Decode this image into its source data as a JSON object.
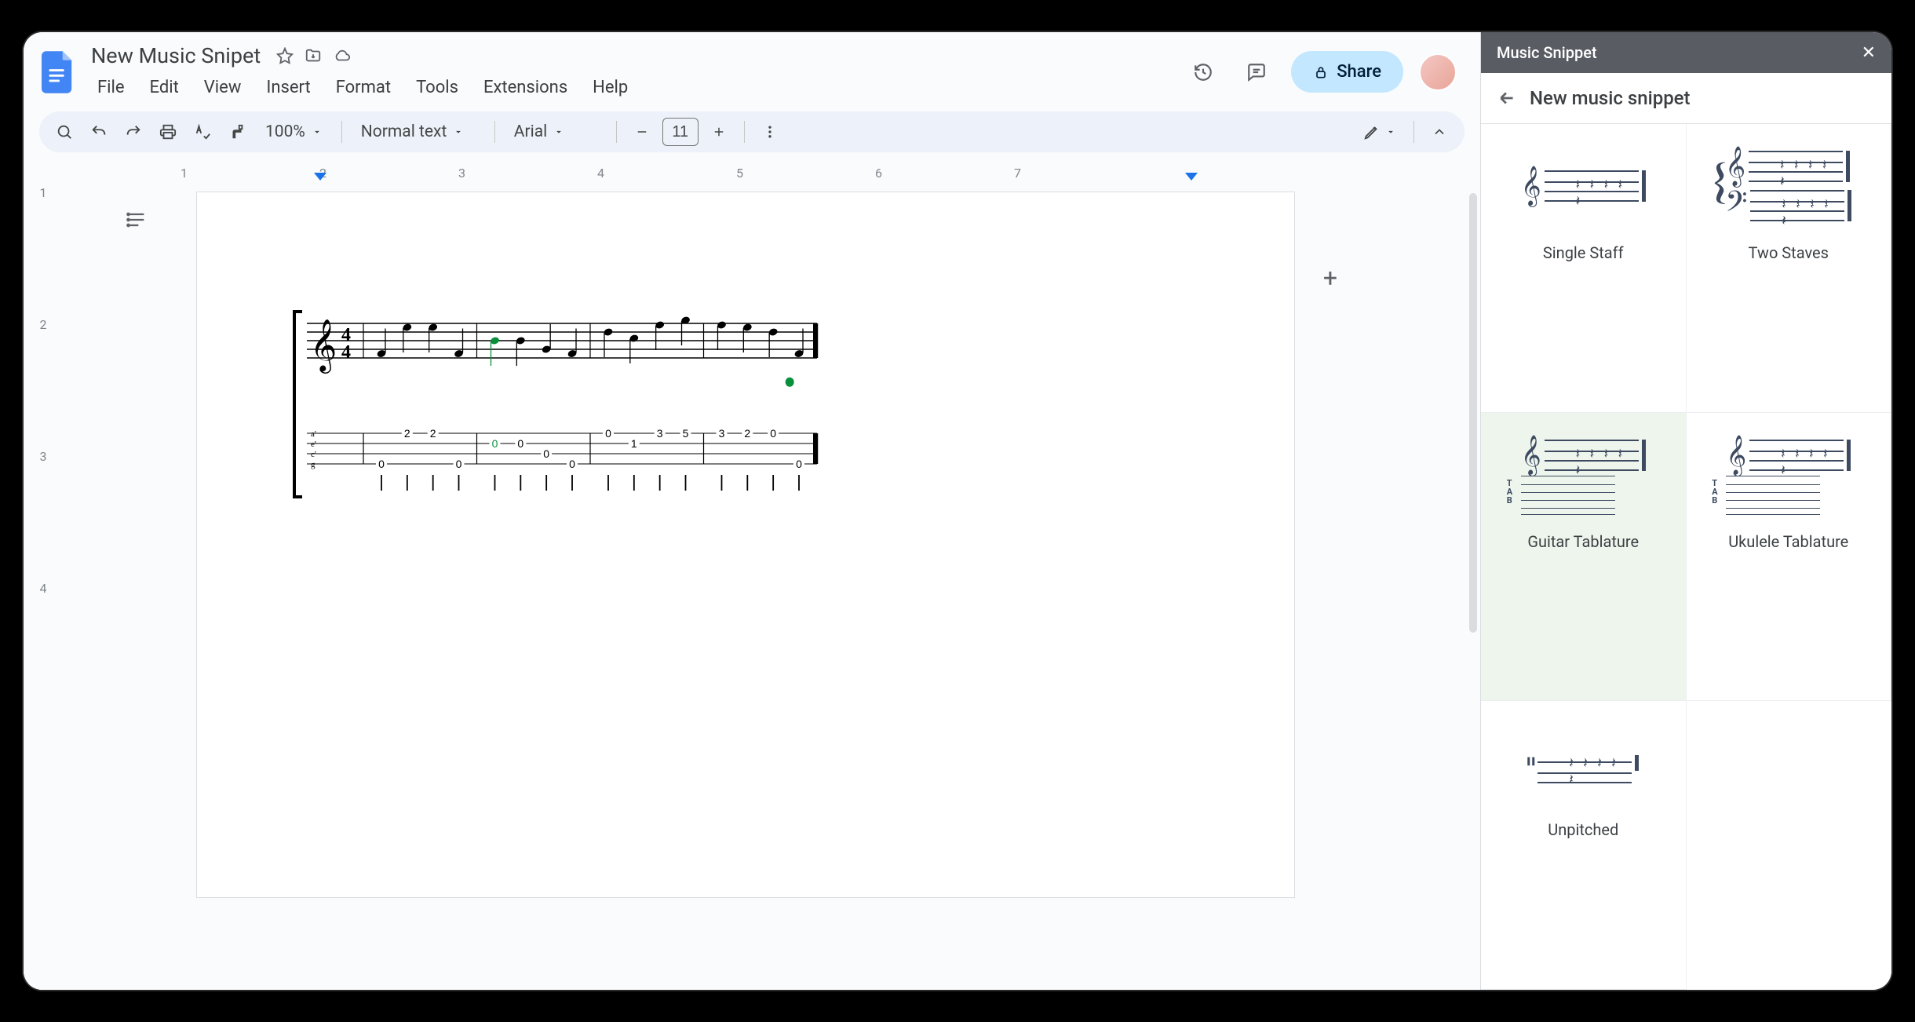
{
  "doc": {
    "title": "New Music Snipet",
    "menus": [
      "File",
      "Edit",
      "View",
      "Insert",
      "Format",
      "Tools",
      "Extensions",
      "Help"
    ]
  },
  "titlebar_actions": {
    "share_label": "Share"
  },
  "toolbar": {
    "zoom": "100%",
    "style": "Normal text",
    "font": "Arial",
    "font_size": "11"
  },
  "h_ruler_ticks": [
    "1",
    "2",
    "3",
    "4",
    "5",
    "6",
    "7"
  ],
  "v_ruler_ticks": [
    "1",
    "2",
    "3",
    "4"
  ],
  "sidebar": {
    "header": "Music Snippet",
    "subtitle": "New music snippet",
    "templates": [
      {
        "label": "Single Staff",
        "kind": "single"
      },
      {
        "label": "Two Staves",
        "kind": "two"
      },
      {
        "label": "Guitar Tablature",
        "kind": "gtab",
        "selected": true
      },
      {
        "label": "Ukulele Tablature",
        "kind": "utab"
      },
      {
        "label": "Unpitched",
        "kind": "unpitched"
      }
    ]
  },
  "tablature": {
    "time_sig": "4/4",
    "strings": [
      "a'",
      "e'",
      "c'",
      "g"
    ],
    "bars": [
      [
        {
          "string": 3,
          "fret": "0"
        },
        {
          "string": 0,
          "fret": "2"
        },
        {
          "string": 0,
          "fret": "2"
        },
        {
          "string": 3,
          "fret": "0"
        }
      ],
      [
        {
          "string": 1,
          "fret": "0",
          "highlight": true
        },
        {
          "string": 1,
          "fret": "0"
        },
        {
          "string": 2,
          "fret": "0"
        },
        {
          "string": 3,
          "fret": "0"
        }
      ],
      [
        {
          "string": 0,
          "fret": "0"
        },
        {
          "string": 1,
          "fret": "1"
        },
        {
          "string": 0,
          "fret": "3"
        },
        {
          "string": 0,
          "fret": "5"
        }
      ],
      [
        {
          "string": 0,
          "fret": "3"
        },
        {
          "string": 0,
          "fret": "2"
        },
        {
          "string": 0,
          "fret": "0"
        },
        {
          "string": 3,
          "fret": "0"
        }
      ]
    ]
  }
}
